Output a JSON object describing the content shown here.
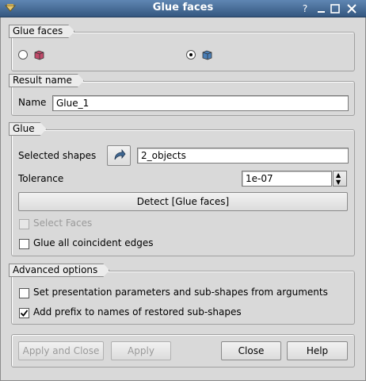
{
  "window": {
    "title": "Glue faces",
    "buttons": {
      "help": "?",
      "minimize": "—",
      "maximize": "☐",
      "close": "✕"
    }
  },
  "glue_faces_group": {
    "title": "Glue faces",
    "option_1_selected": false,
    "option_2_selected": true,
    "option_1_icon": "glue-by-list-icon",
    "option_2_icon": "glue-faces-icon"
  },
  "result_name": {
    "title": "Result name",
    "name_label": "Name",
    "name_value": "Glue_1"
  },
  "glue_group": {
    "title": "Glue",
    "selected_shapes_label": "Selected shapes",
    "selected_shapes_value": "2_objects",
    "tolerance_label": "Tolerance",
    "tolerance_value": "1e-07",
    "detect_button": "Detect [Glue faces]",
    "select_faces_label": "Select Faces",
    "select_faces_checked": false,
    "glue_edges_label": "Glue all coincident edges",
    "glue_edges_checked": false
  },
  "advanced_options": {
    "title": "Advanced options",
    "set_presentation_label": "Set presentation parameters and sub-shapes from arguments",
    "set_presentation_checked": false,
    "add_prefix_label": "Add prefix to names of restored sub-shapes",
    "add_prefix_checked": true
  },
  "footer": {
    "apply_and_close": "Apply and Close",
    "apply": "Apply",
    "close": "Close",
    "help": "Help"
  }
}
